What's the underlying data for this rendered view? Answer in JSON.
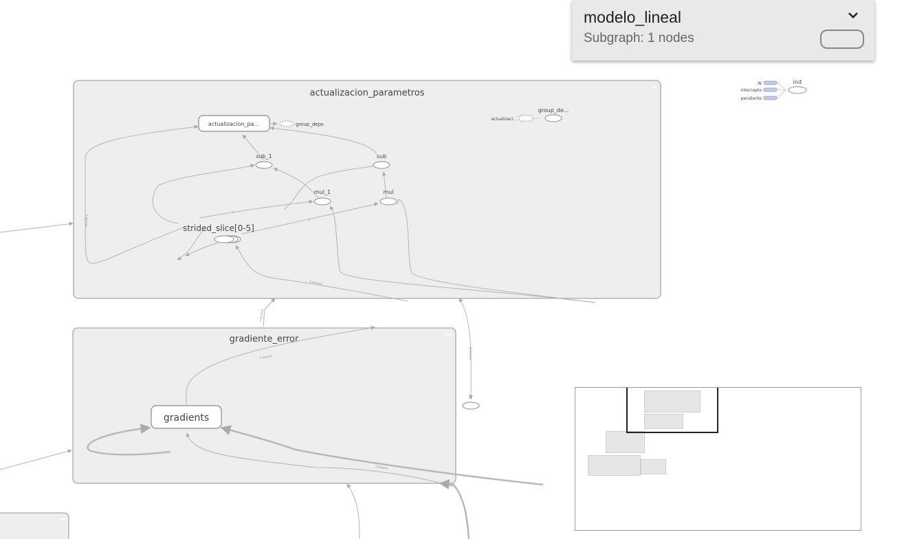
{
  "info_card": {
    "title": "modelo_lineal",
    "subtitle": "Subgraph: 1 nodes",
    "expand_icon": "chevron-down-icon"
  },
  "clusters": {
    "actualizacion": "actualizacion_parametros",
    "gradiente": "gradiente_error"
  },
  "nodes": {
    "actualizacion_pa": "actualizacion_pa...",
    "group_deps": "group_deps",
    "group_de": "group_de...",
    "actualizaci": "actualizaci...",
    "sub_1": "sub_1",
    "sub": "sub",
    "mul_1": "mul_1",
    "mul": "mul",
    "strided_slice": "strided_slice[0-5]",
    "gradients": "gradients",
    "lr": "lr",
    "init": "init",
    "w": "W",
    "intercepto": "intercepto",
    "pendiente": "pendiente"
  },
  "edge_labels": {
    "two_tensors": "2 tensors",
    "e1": "2 tensors",
    "e2": "2 tensors",
    "e3": "2 tensors",
    "e4": "2 tensors",
    "e5": "2 tensors",
    "scalar1": "1",
    "scalar2": "1"
  },
  "colors": {
    "cluster_fill": "#eeeeee",
    "cluster_stroke": "#a8a8a8",
    "edge": "#b4b4b4",
    "card_bg": "#e9e9e9"
  }
}
